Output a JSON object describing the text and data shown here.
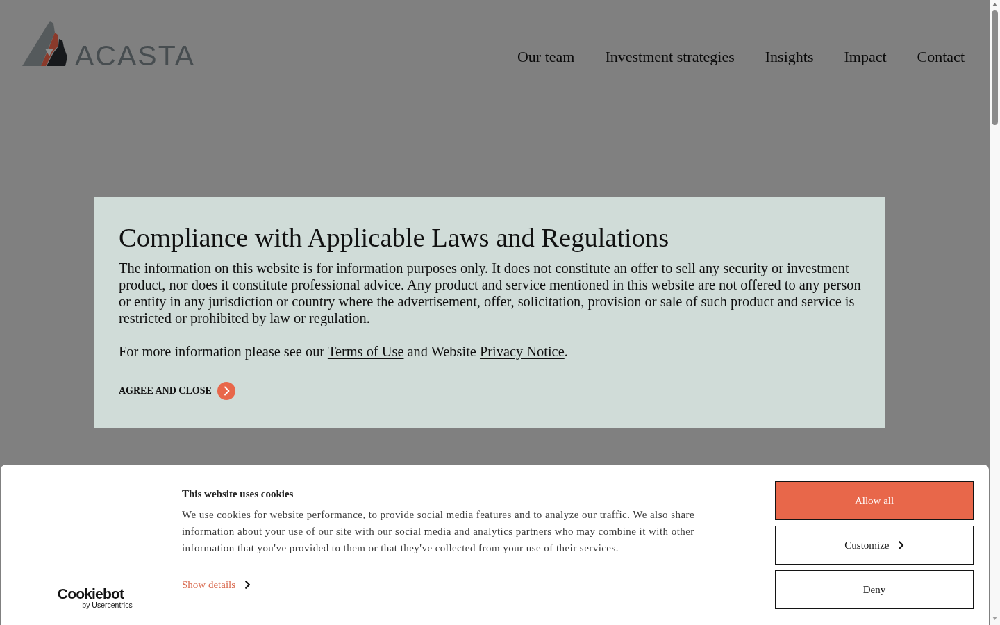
{
  "header": {
    "logo": {
      "wordmark": "ACASTA"
    },
    "nav": [
      {
        "label": "Our team"
      },
      {
        "label": "Investment strategies"
      },
      {
        "label": "Insights"
      },
      {
        "label": "Impact"
      },
      {
        "label": "Contact"
      }
    ]
  },
  "compliance_dialog": {
    "title": "Compliance with Applicable Laws and Regulations",
    "paragraph": "The information on this website is for information purposes only. It does not constitute an offer to sell any security or investment product, nor does it constitute professional advice. Any product and service mentioned in this website are not offered to any person or entity in any jurisdiction or country where the advertisement, offer, solicitation, provision or sale of such product and service is restricted or prohibited by law or regulation.",
    "more_info": [
      {
        "kind": "text",
        "text": "For more information please see our "
      },
      {
        "kind": "link",
        "text": "Terms of Use"
      },
      {
        "kind": "text",
        "text": " and Website "
      },
      {
        "kind": "link",
        "text": "Privacy Notice"
      },
      {
        "kind": "text",
        "text": "."
      }
    ],
    "agree_button": "AGREE AND CLOSE"
  },
  "cookie_banner": {
    "brand": {
      "name": "Cookiebot",
      "byline": "by Usercentrics"
    },
    "title": "This website uses cookies",
    "text": "We use cookies for website performance, to provide social media features and to analyze our traffic. We also share information about your use of our site with our social media and analytics partners who may combine it with other information that you've provided to them or that they've collected from your use of their services.",
    "show_details": "Show details",
    "buttons": [
      {
        "label": "Allow all",
        "kind": "filled"
      },
      {
        "label": "Customize",
        "kind": "expand"
      },
      {
        "label": "Deny",
        "kind": "outline"
      }
    ]
  }
}
